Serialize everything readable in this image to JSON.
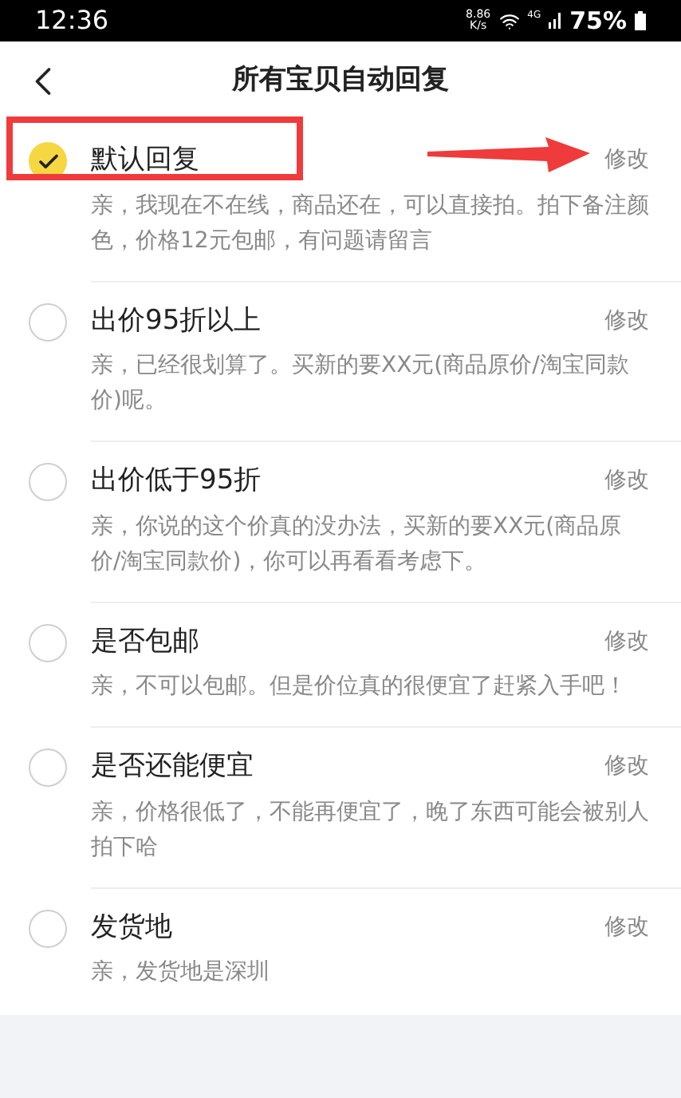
{
  "status_bar": {
    "time": "12:36",
    "speed_value": "8.86",
    "speed_unit": "K/s",
    "network": "4G",
    "battery": "75%"
  },
  "header": {
    "title": "所有宝贝自动回复"
  },
  "replies": [
    {
      "title": "默认回复",
      "text": "亲，我现在不在线，商品还在，可以直接拍。拍下备注颜色，价格12元包邮，有问题请留言",
      "action": "修改",
      "selected": true
    },
    {
      "title": "出价95折以上",
      "text": "亲，已经很划算了。买新的要XX元(商品原价/淘宝同款价)呢。",
      "action": "修改",
      "selected": false
    },
    {
      "title": "出价低于95折",
      "text": "亲，你说的这个价真的没办法，买新的要XX元(商品原价/淘宝同款价)，你可以再看看考虑下。",
      "action": "修改",
      "selected": false
    },
    {
      "title": "是否包邮",
      "text": "亲，不可以包邮。但是价位真的很便宜了赶紧入手吧！",
      "action": "修改",
      "selected": false
    },
    {
      "title": "是否还能便宜",
      "text": "亲，价格很低了，不能再便宜了，晚了东西可能会被别人拍下哈",
      "action": "修改",
      "selected": false
    },
    {
      "title": "发货地",
      "text": "亲，发货地是深圳",
      "action": "修改",
      "selected": false
    }
  ]
}
